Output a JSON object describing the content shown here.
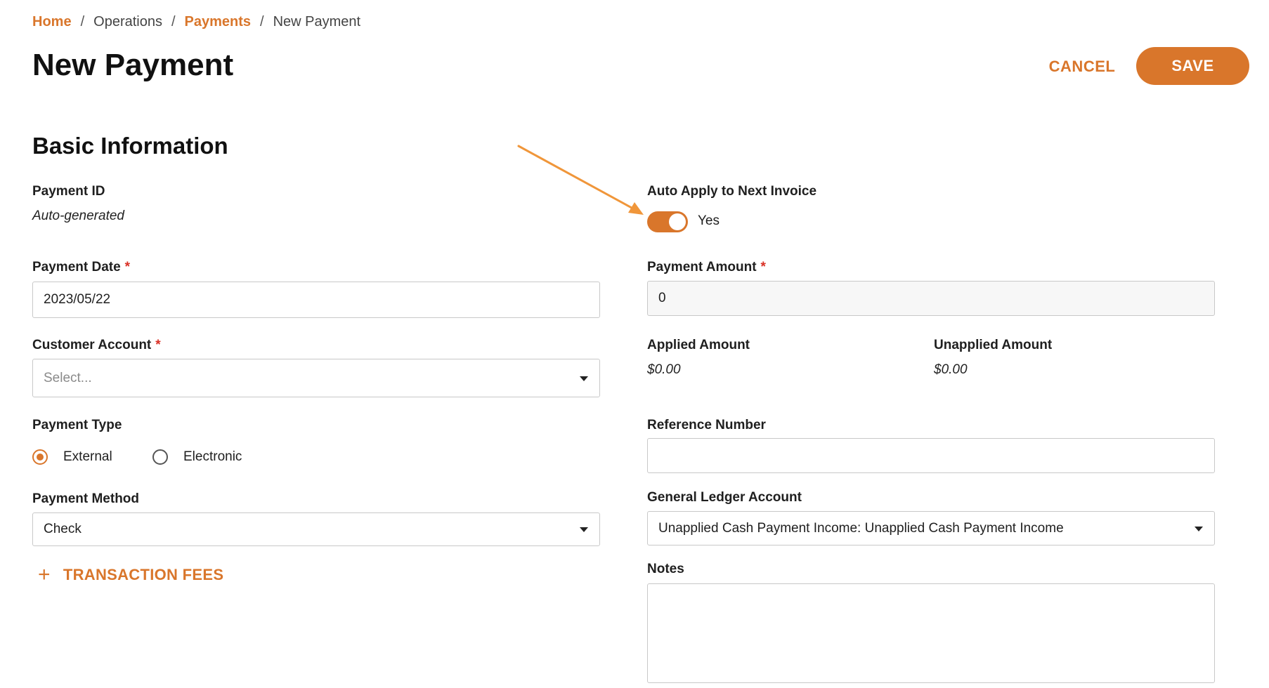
{
  "breadcrumb": {
    "items": [
      {
        "label": "Home",
        "link": true
      },
      {
        "label": "Operations",
        "link": false
      },
      {
        "label": "Payments",
        "link": true
      },
      {
        "label": "New Payment",
        "link": false
      }
    ],
    "separator": "/"
  },
  "page": {
    "title": "New Payment"
  },
  "actions": {
    "cancel_label": "CANCEL",
    "save_label": "SAVE"
  },
  "section": {
    "title": "Basic Information"
  },
  "form": {
    "payment_id": {
      "label": "Payment ID",
      "value": "Auto-generated"
    },
    "auto_apply": {
      "label": "Auto Apply to Next Invoice",
      "state_text": "Yes",
      "enabled": true
    },
    "payment_date": {
      "label": "Payment Date",
      "required_mark": "*",
      "value": "2023/05/22"
    },
    "payment_amount": {
      "label": "Payment Amount",
      "required_mark": "*",
      "value": "0"
    },
    "customer_account": {
      "label": "Customer Account",
      "required_mark": "*",
      "placeholder": "Select..."
    },
    "applied_amount": {
      "label": "Applied Amount",
      "value": "$0.00"
    },
    "unapplied_amount": {
      "label": "Unapplied Amount",
      "value": "$0.00"
    },
    "payment_type": {
      "label": "Payment Type",
      "options": [
        "External",
        "Electronic"
      ],
      "selected": "External"
    },
    "reference_number": {
      "label": "Reference Number",
      "value": ""
    },
    "payment_method": {
      "label": "Payment Method",
      "value": "Check"
    },
    "general_ledger_account": {
      "label": "General Ledger Account",
      "value": "Unapplied Cash Payment Income: Unapplied Cash Payment Income"
    },
    "notes": {
      "label": "Notes",
      "value": ""
    },
    "transaction_fees": {
      "icon": "plus",
      "label": "TRANSACTION FEES"
    }
  },
  "colors": {
    "accent": "#d9762b",
    "required": "#d93025",
    "annotation_arrow": "#f0963a"
  },
  "icons": [
    "chevron-down-icon",
    "plus-icon",
    "arrow-annotation-icon"
  ]
}
